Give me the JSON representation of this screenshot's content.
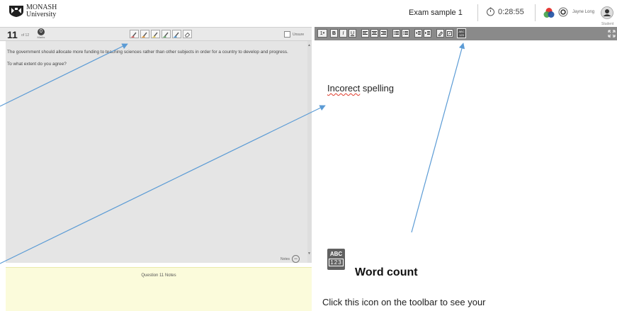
{
  "header": {
    "logo_line1": "MONASH",
    "logo_line2": "University",
    "exam_title": "Exam sample 1",
    "timer": "0:28:55",
    "user_name": "Jayne Long",
    "user_role": "Student"
  },
  "question": {
    "number": "11",
    "of_label": "of 12",
    "marks_value": "0",
    "marks_label": "Marks",
    "unsure_label": "Unsure",
    "paragraphs": [
      "The government should allocate more funding to teaching sciences rather than other subjects in order for a country to develop and progress.",
      "To what extent do you agree?"
    ],
    "notes_toggle_label": "Notes"
  },
  "highlighter": {
    "colors": [
      "#e53935",
      "#fb8c00",
      "#fdd835",
      "#43a047",
      "#1e88e5"
    ],
    "eraser_icon": "eraser-icon"
  },
  "editor_toolbar": {
    "font_size_label": "1",
    "bold": "B",
    "italic": "I",
    "underline": "U",
    "word_count_abc": "ABC",
    "word_count_nums": "123",
    "expand_icon": "expand-icon"
  },
  "notes": {
    "title": "Question 11 Notes"
  },
  "answer": {
    "misspelled_word": "Incorect",
    "rest_text": " spelling"
  },
  "callout": {
    "icon_abc": "ABC",
    "icon_nums": "123",
    "title": "Word count",
    "description": "Click this icon on the toolbar to see your"
  },
  "colors": {
    "arrow": "#5b9bd5",
    "notes_bg": "#fbfbdb",
    "question_bg": "#e5e5e5",
    "toolbar_dark": "#8a8a8a",
    "spell_error": "#e03b2b"
  }
}
